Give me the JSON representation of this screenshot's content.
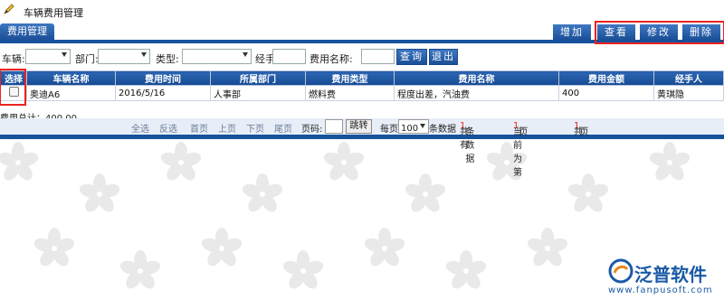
{
  "page": {
    "title": "车辆费用管理"
  },
  "toolbar": {
    "tab_label": "费用管理",
    "buttons": {
      "add": "增加",
      "view": "查看",
      "edit": "修改",
      "delete": "删除"
    }
  },
  "filters": {
    "vehicle_label": "车辆:",
    "dept_label": "部门:",
    "type_label": "类型:",
    "handler_label": "经手人:",
    "cost_name_label": "费用名称:",
    "search_label": "查询",
    "exit_label": "退出"
  },
  "table": {
    "headers": [
      "选择",
      "车辆名称",
      "费用时间",
      "所属部门",
      "费用类型",
      "费用名称",
      "费用金额",
      "经手人"
    ],
    "rows": [
      {
        "vehicle": "奥迪A6",
        "date": "2016/5/16",
        "dept": "人事部",
        "type": "燃料费",
        "name": "程度出差，汽油费",
        "amount": "400",
        "handler": "黄琪隐"
      }
    ]
  },
  "summary": {
    "total_label": "费用总计：400.00"
  },
  "pager": {
    "select_all": "全选",
    "invert": "反选",
    "first": "首页",
    "prev": "上页",
    "next": "下页",
    "last": "尾页",
    "page_label": "页码:",
    "jump": "跳转",
    "per_page_label": "每页",
    "per_page_value": "100",
    "per_page_suffix": "条数据",
    "total_prefix": "共有",
    "total_count": "1",
    "total_suffix": "条数据",
    "current_prefix": "当前为第",
    "current_page": "1",
    "current_suffix": "页",
    "pages_prefix": "共",
    "pages_count": "1",
    "pages_suffix": "页"
  },
  "logo": {
    "brand": "泛普软件",
    "url": "www.fanpusoft.com"
  },
  "colors": {
    "accent": "#17529c",
    "highlight": "#e22222"
  }
}
